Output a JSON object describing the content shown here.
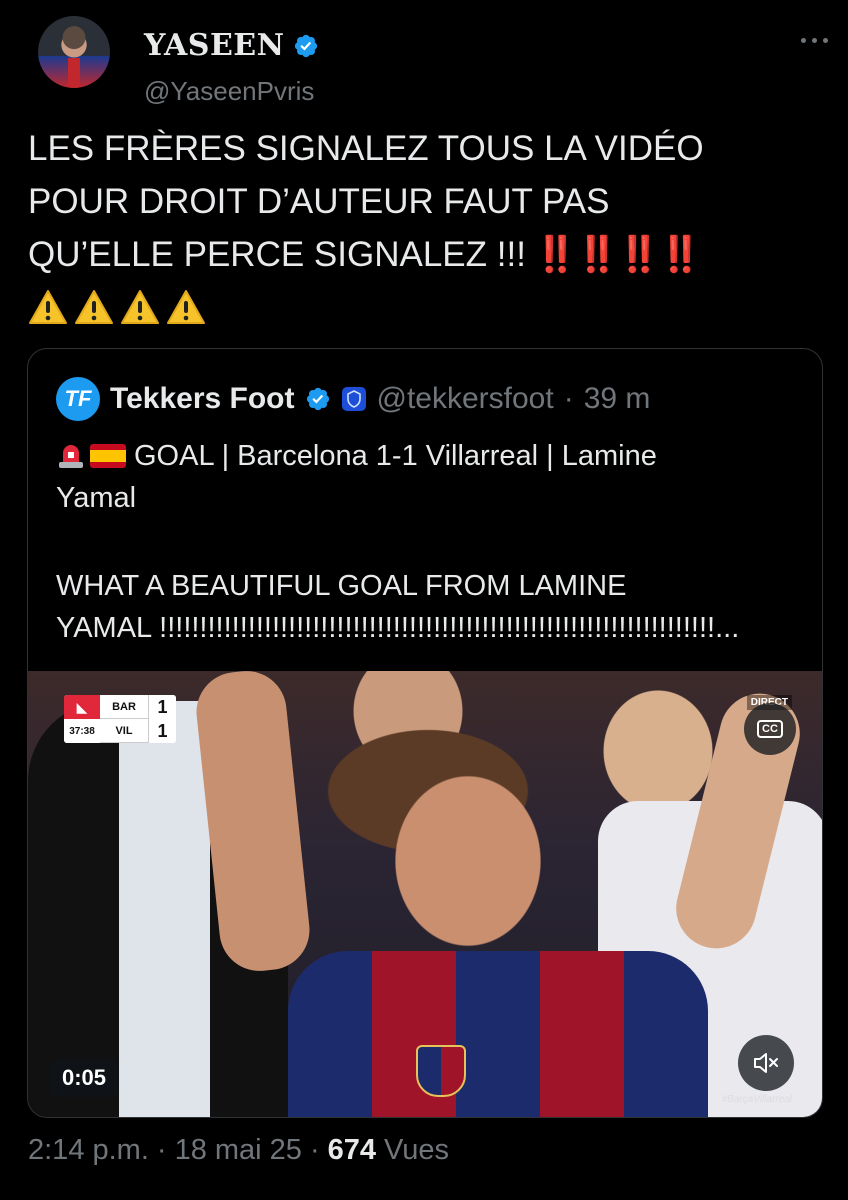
{
  "author": {
    "display_name": "YASEEN",
    "handle": "@YaseenPvris",
    "verified_color": "#1d9bf0"
  },
  "tweet": {
    "text": "LES FRÈRES SIGNALEZ TOUS LA VIDÉO\nPOUR DROIT D’AUTEUR FAUT PAS\nQU’ELLE PERCE SIGNALEZ !!!",
    "emojis": "‼️‼️‼️‼️",
    "warning_icons": [
      "warning-icon",
      "warning-icon",
      "warning-icon",
      "warning-icon"
    ]
  },
  "quoted": {
    "logo_text": "TF",
    "name": "Tekkers Foot",
    "handle": "@tekkersfoot",
    "separator": "·",
    "time": "39 m",
    "line1": "GOAL | Barcelona 1-1 Villarreal | Lamine",
    "line2": "Yamal",
    "line3": "WHAT A BEAUTIFUL GOAL FROM LAMINE",
    "line4": "YAMAL !!!!!!!!!!!!!!!!!!!!!!!!!!!!!!!!!!!!!!!!!!!!!!!!!!!!!!!!!!!!!!!!!!!!!...",
    "video": {
      "timer": "0:05",
      "cc_label": "CC",
      "scoreboard": {
        "home": "BAR",
        "away": "VIL",
        "home_score": "1",
        "away_score": "1",
        "time": "37:38"
      },
      "broadcaster": "DIRECT",
      "hashtag": "#BarçaVillarreal"
    }
  },
  "meta": {
    "time": "2:14 p.m.",
    "date": "18 mai 25",
    "views_count": "674",
    "views_label": "Vues",
    "separator": "·"
  },
  "colors": {
    "background": "#000000",
    "text": "#e7e9ea",
    "muted": "#71767b",
    "accent": "#1d9bf0",
    "alert": "#e0283a"
  }
}
